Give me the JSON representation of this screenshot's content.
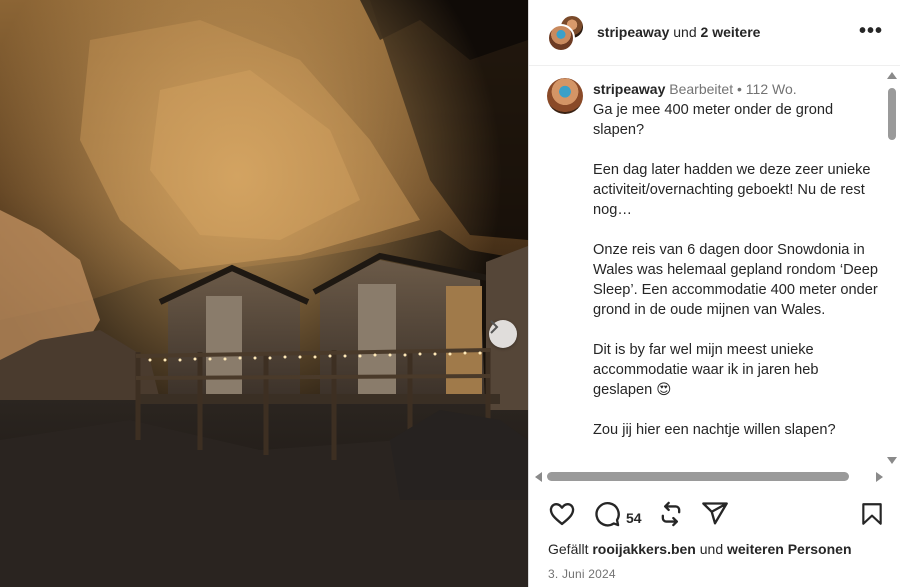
{
  "post": {
    "image_alt": "",
    "next_icon": "chevron-right-icon"
  },
  "header": {
    "username": "stripeaway",
    "and_text": "und",
    "others": "2 weitere",
    "more_icon": "more-horizontal-icon"
  },
  "caption": {
    "username": "stripeaway",
    "edited": "Bearbeitet",
    "separator": "•",
    "time_ago": "112 Wo.",
    "paragraphs": [
      "Ga je mee 400 meter onder de grond slapen?",
      "Een dag later hadden we deze zeer unieke activiteit/overnachting geboekt! Nu de rest nog…",
      "Onze reis van 6 dagen door Snowdonia in Wales was helemaal gepland rondom ‘Deep Sleep’. Een accommodatie 400 meter onder grond in de oude mijnen van Wales.",
      "Dit is by far wel mijn meest unieke accommodatie waar ik in jaren heb geslapen 😍",
      "Zou jij hier een nachtje willen slapen?"
    ]
  },
  "actions": {
    "like_icon": "heart-icon",
    "comment_icon": "comment-icon",
    "comment_count": "54",
    "repost_icon": "repost-icon",
    "share_icon": "send-icon",
    "save_icon": "bookmark-icon"
  },
  "likes": {
    "prefix": "Gefällt",
    "user": "rooijakkers.ben",
    "middle": "und",
    "suffix": "weiteren Personen"
  },
  "date": "3. Juni 2024",
  "colors": {
    "text": "#262626",
    "muted": "#737373",
    "scrollbar": "#9a9a9a"
  }
}
